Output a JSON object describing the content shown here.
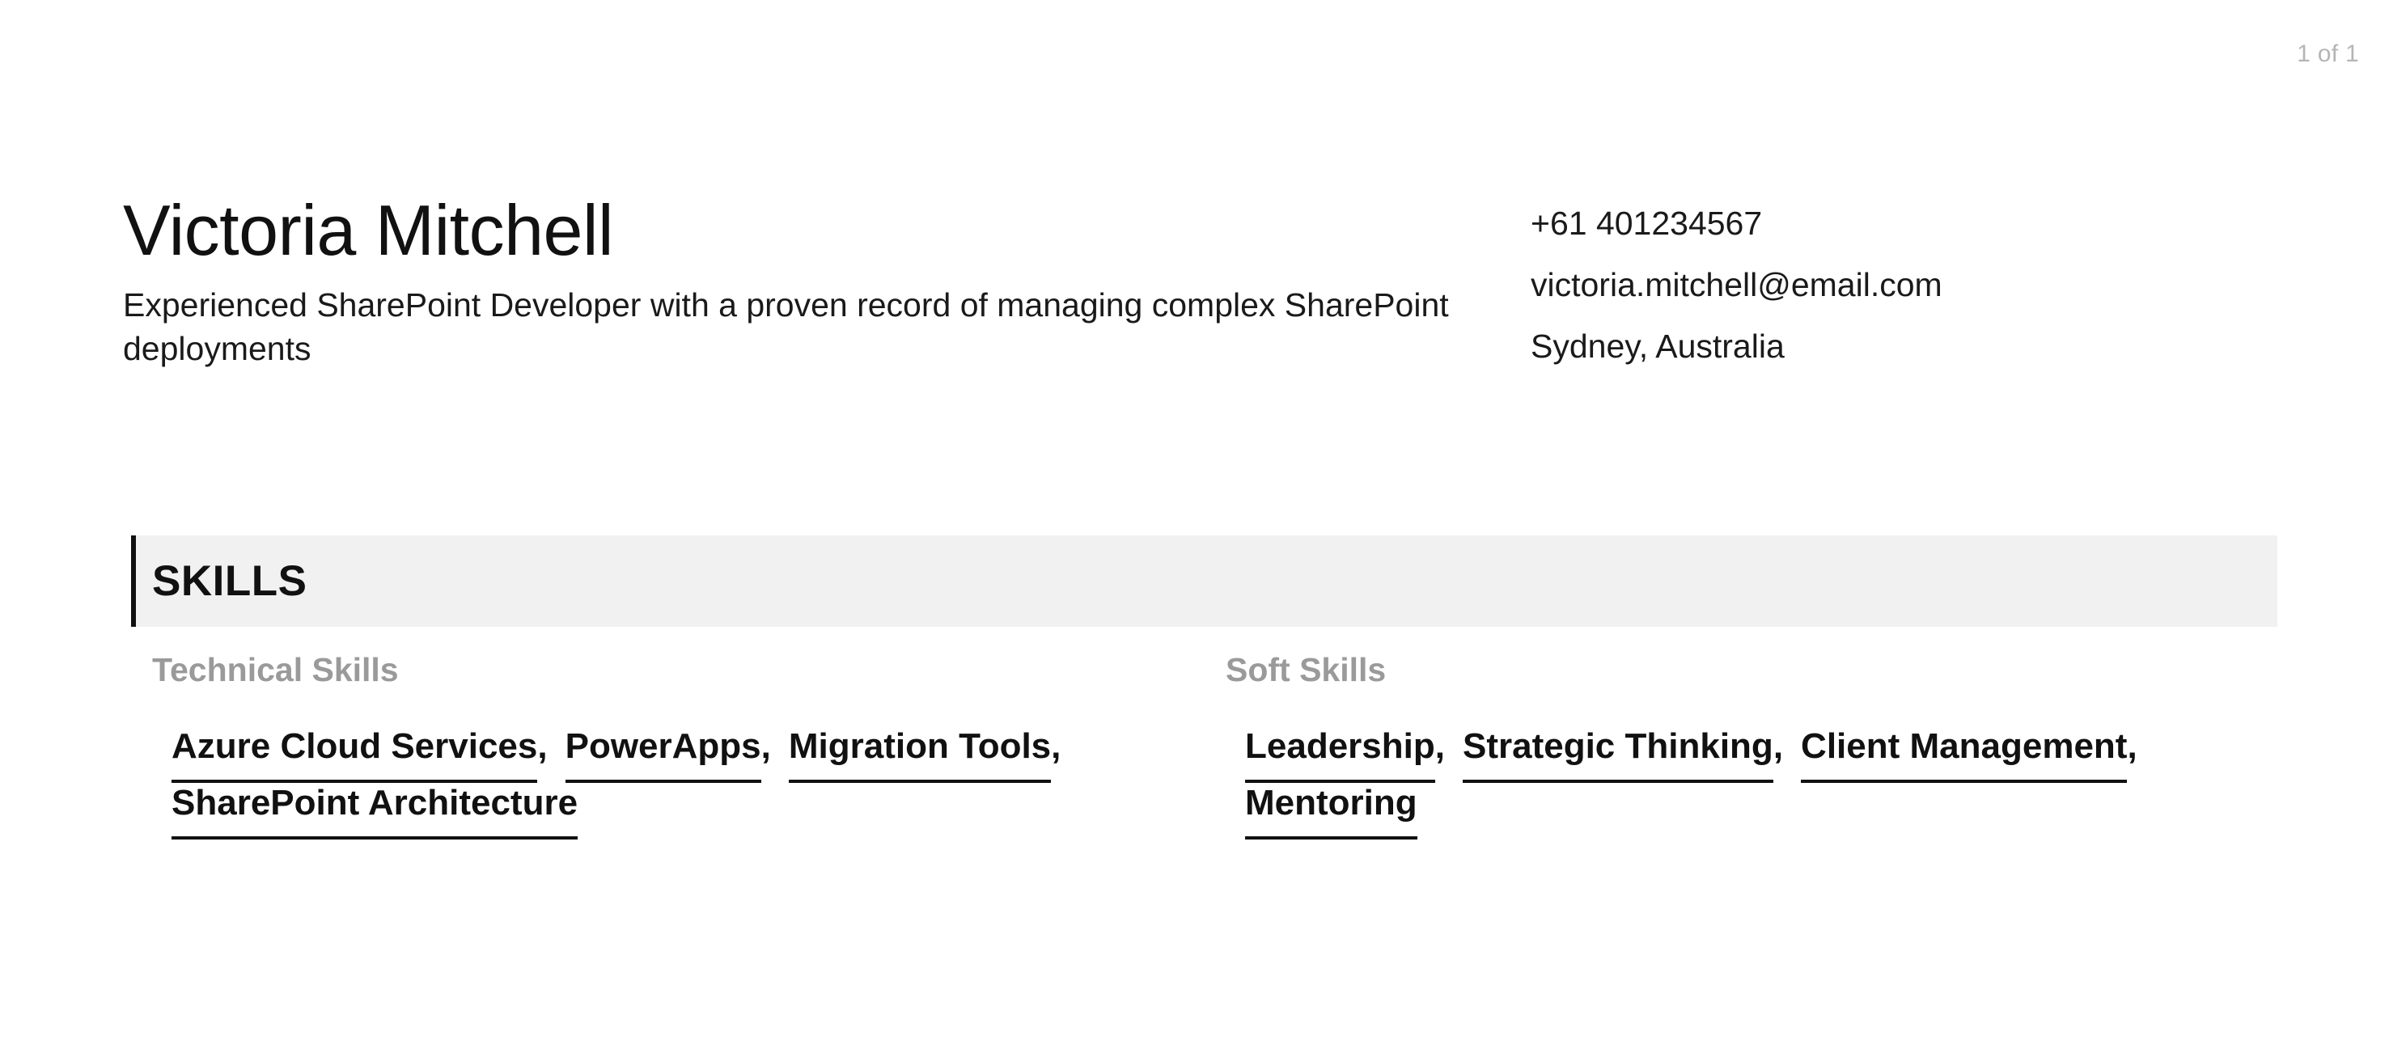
{
  "viewer": {
    "page_indicator": "1 of 1"
  },
  "resume": {
    "header": {
      "full_name": "Victoria Mitchell",
      "summary": "Experienced SharePoint Developer with a proven record of managing complex SharePoint deployments",
      "contact": {
        "phone": "+61 401234567",
        "email": "victoria.mitchell@email.com",
        "location": "Sydney, Australia"
      }
    },
    "sections": [
      {
        "title": "SKILLS",
        "accent_color": "#111111",
        "bar_background": "#f1f1f1",
        "groups": [
          {
            "title": "Technical Skills",
            "title_color": "#9a9a9a",
            "separator": ",",
            "skills": [
              "Azure Cloud Services",
              "PowerApps",
              "Migration Tools",
              "SharePoint Architecture"
            ]
          },
          {
            "title": "Soft Skills",
            "title_color": "#9a9a9a",
            "separator": ",",
            "skills": [
              "Leadership",
              "Strategic Thinking",
              "Client Management",
              "Mentoring"
            ]
          }
        ]
      }
    ]
  }
}
